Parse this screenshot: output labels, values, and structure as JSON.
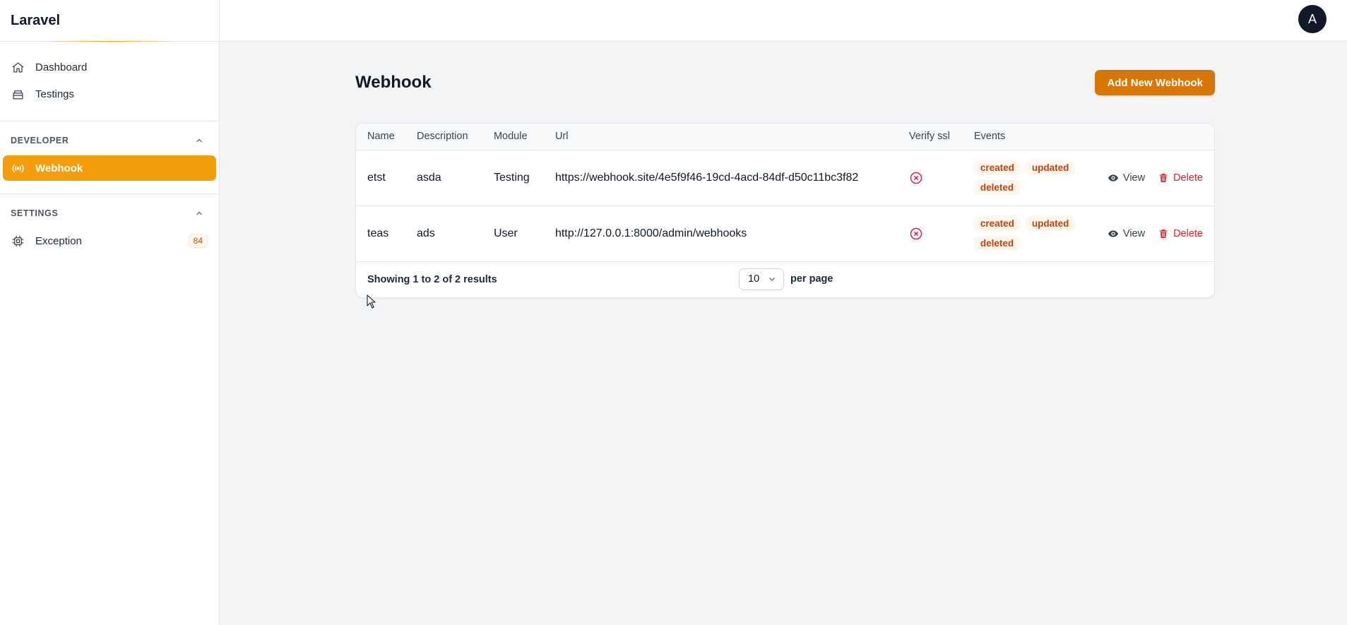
{
  "app": {
    "brand": "Laravel",
    "avatar_initial": "A"
  },
  "sidebar": {
    "items": [
      {
        "label": "Dashboard",
        "icon": "home-icon"
      },
      {
        "label": "Testings",
        "icon": "box-icon"
      }
    ],
    "groups": [
      {
        "title": "DEVELOPER",
        "items": [
          {
            "label": "Webhook",
            "icon": "signal-icon",
            "active": true
          }
        ]
      },
      {
        "title": "SETTINGS",
        "items": [
          {
            "label": "Exception",
            "icon": "chip-icon",
            "badge": "84"
          }
        ]
      }
    ]
  },
  "page": {
    "title": "Webhook",
    "add_button": "Add New Webhook"
  },
  "table": {
    "columns": [
      "Name",
      "Description",
      "Module",
      "Url",
      "Verify ssl",
      "Events",
      ""
    ],
    "rows": [
      {
        "name": "etst",
        "description": "asda",
        "module": "Testing",
        "url": "https://webhook.site/4e5f9f46-19cd-4acd-84df-d50c11bc3f82",
        "verify_ssl": false,
        "events": [
          "created",
          "updated",
          "deleted"
        ],
        "view_label": "View",
        "delete_label": "Delete"
      },
      {
        "name": "teas",
        "description": "ads",
        "module": "User",
        "url": "http://127.0.0.1:8000/admin/webhooks",
        "verify_ssl": false,
        "events": [
          "created",
          "updated",
          "deleted"
        ],
        "view_label": "View",
        "delete_label": "Delete"
      }
    ]
  },
  "pagination": {
    "summary": "Showing 1 to 2 of 2 results",
    "per_page_value": "10",
    "per_page_label": "per page"
  },
  "colors": {
    "accent": "#f59e0b",
    "button": "#d97706",
    "danger": "#dc2626",
    "tag_text": "#c2410c",
    "tag_bg": "#fff7ed"
  }
}
